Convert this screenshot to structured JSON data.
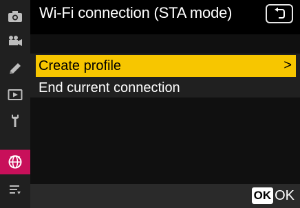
{
  "header": {
    "title": "Wi-Fi connection (STA mode)"
  },
  "menu": {
    "items": [
      {
        "label": "Create profile",
        "selected": true,
        "chevron": ">"
      },
      {
        "label": "End current connection",
        "selected": false
      }
    ]
  },
  "footer": {
    "ok_box": "OK",
    "ok_label": "OK"
  },
  "tabs": [
    {
      "icon": "camera-icon"
    },
    {
      "icon": "movie-icon"
    },
    {
      "icon": "pencil-icon"
    },
    {
      "icon": "playback-icon"
    },
    {
      "icon": "wrench-icon"
    },
    {
      "icon": "network-icon",
      "active": true
    },
    {
      "icon": "my-menu-icon"
    }
  ],
  "colors": {
    "accent_selected": "#f7c600",
    "active_tab": "#c8105a",
    "tab_strip": "#202020",
    "background": "#000000"
  }
}
